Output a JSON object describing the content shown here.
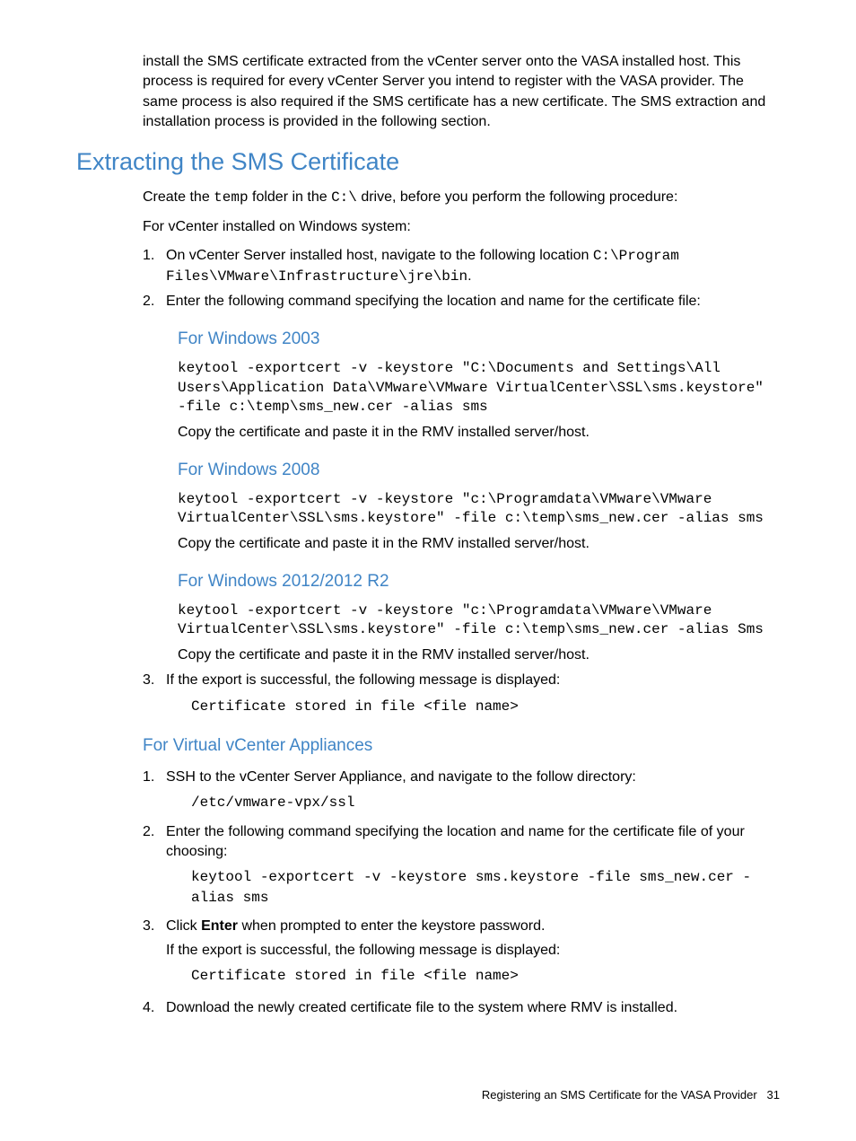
{
  "intro_para": "install the SMS certificate extracted from the vCenter server onto the VASA installed host. This process is required for every vCenter Server you intend to register with the VASA provider. The same process is also required if the SMS certificate has a new certificate. The SMS extraction and installation process is provided in the following section.",
  "heading_extracting": "Extracting the SMS Certificate",
  "create_temp_pre": "Create the ",
  "temp_code": "temp",
  "create_temp_mid": " folder in the ",
  "cdrive_code": "C:\\",
  "create_temp_post": " drive, before you perform the following procedure:",
  "for_vcenter_windows": "For vCenter installed on Windows system:",
  "step1_num": "1.",
  "step1_pre": "On vCenter Server installed host, navigate to the following location ",
  "step1_path": "C:\\Program Files\\VMware\\Infrastructure\\jre\\bin",
  "step1_post": ".",
  "step2_num": "2.",
  "step2_text": "Enter the following command specifying the location and name for the certificate file:",
  "win2003_heading": "For Windows 2003",
  "win2003_cmd": "keytool -exportcert -v -keystore \"C:\\Documents and Settings\\All Users\\Application Data\\VMware\\VMware VirtualCenter\\SSL\\sms.keystore\" -file c:\\temp\\sms_new.cer -alias sms",
  "copy_paste": "Copy the certificate and paste it in the RMV installed server/host.",
  "win2008_heading": "For Windows 2008",
  "win2008_cmd": "keytool -exportcert -v -keystore \"c:\\Programdata\\VMware\\VMware VirtualCenter\\SSL\\sms.keystore\" -file c:\\temp\\sms_new.cer -alias sms",
  "win2012_heading": "For Windows 2012/2012 R2",
  "win2012_cmd": "keytool -exportcert -v -keystore \"c:\\Programdata\\VMware\\VMware VirtualCenter\\SSL\\sms.keystore\" -file c:\\temp\\sms_new.cer -alias Sms",
  "step3_num": "3.",
  "step3_text": "If the export is successful, the following message is displayed:",
  "cert_stored": "Certificate stored in file <file name>",
  "virtual_appliances_heading": "For Virtual vCenter Appliances",
  "va_step1_num": "1.",
  "va_step1_text": "SSH to the vCenter Server Appliance, and navigate to the follow directory:",
  "va_step1_path": "/etc/vmware-vpx/ssl",
  "va_step2_num": "2.",
  "va_step2_text": "Enter the following command specifying the location and name for the certificate file of your choosing:",
  "va_step2_cmd": "keytool -exportcert -v -keystore sms.keystore -file sms_new.cer -alias sms",
  "va_step3_num": "3.",
  "va_step3_pre": "Click ",
  "va_step3_enter": "Enter",
  "va_step3_post": " when prompted to enter the keystore password.",
  "va_step3_line2": "If the export is successful, the following message is displayed:",
  "va_step4_num": "4.",
  "va_step4_text": "Download the newly created certificate file to the system where RMV is installed.",
  "footer_text": "Registering an SMS Certificate for the VASA Provider",
  "footer_page": "31"
}
